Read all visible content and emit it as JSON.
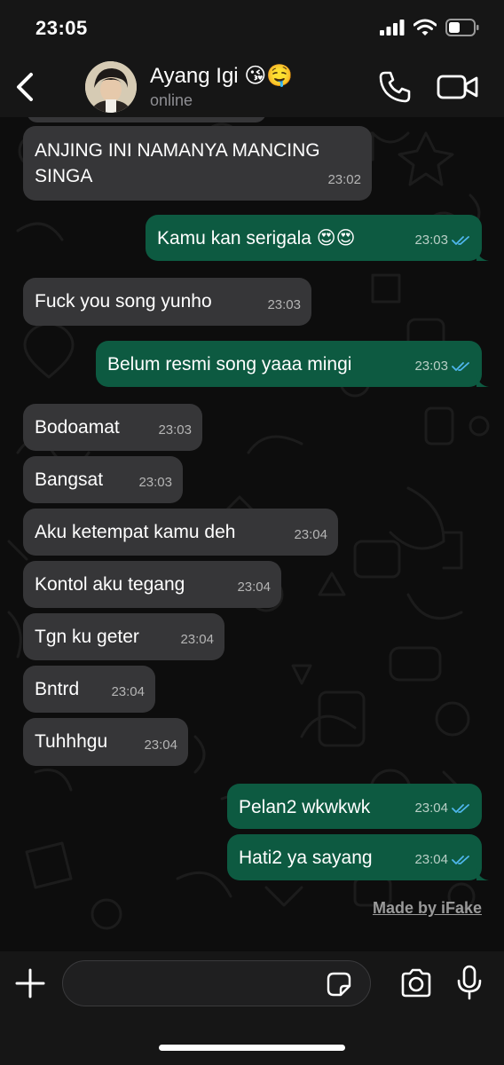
{
  "status_bar": {
    "time": "23:05"
  },
  "header": {
    "back_icon": "chevron-left-icon",
    "contact_name": "Ayang Igi 😘🤤",
    "contact_status": "online",
    "call_icon": "phone-icon",
    "video_icon": "video-camera-icon"
  },
  "colors": {
    "incoming_bubble": "#363638",
    "outgoing_bubble": "#0d5a41",
    "read_ticks": "#4fb6ec",
    "background": "#0d0d0d"
  },
  "messages": [
    {
      "direction": "in",
      "text_line1": "ANJING INI NAMANYA MANCING",
      "text_line2": "SINGA",
      "time": "23:02"
    },
    {
      "direction": "out",
      "text": "Kamu kan serigala 😍😍",
      "time": "23:03",
      "status": "read"
    },
    {
      "direction": "in",
      "text": "Fuck you song yunho",
      "time": "23:03"
    },
    {
      "direction": "out",
      "text": "Belum resmi song yaaa mingi",
      "time": "23:03",
      "status": "read"
    },
    {
      "direction": "in",
      "text": "Bodoamat",
      "time": "23:03"
    },
    {
      "direction": "in",
      "text": "Bangsat",
      "time": "23:03"
    },
    {
      "direction": "in",
      "text": "Aku ketempat kamu deh",
      "time": "23:04"
    },
    {
      "direction": "in",
      "text": "Kontol aku tegang",
      "time": "23:04"
    },
    {
      "direction": "in",
      "text": "Tgn ku geter",
      "time": "23:04"
    },
    {
      "direction": "in",
      "text": "Bntrd",
      "time": "23:04"
    },
    {
      "direction": "in",
      "text": "Tuhhhgu",
      "time": "23:04"
    },
    {
      "direction": "out",
      "text": "Pelan2 wkwkwk",
      "time": "23:04",
      "status": "read"
    },
    {
      "direction": "out",
      "text": "Hati2 ya sayang",
      "time": "23:04",
      "status": "read"
    }
  ],
  "watermark": "Made by iFake",
  "input_bar": {
    "placeholder": "",
    "plus_icon": "plus-icon",
    "sticker_icon": "sticker-icon",
    "camera_icon": "camera-icon",
    "mic_icon": "microphone-icon"
  }
}
